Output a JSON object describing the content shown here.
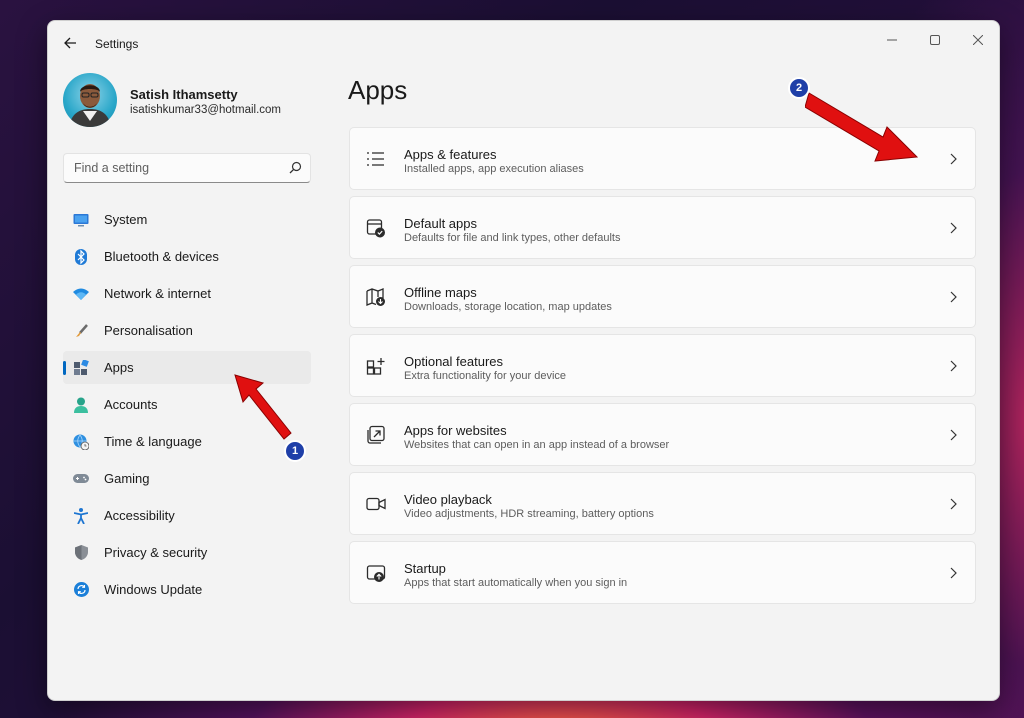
{
  "window": {
    "title": "Settings"
  },
  "profile": {
    "name": "Satish Ithamsetty",
    "email": "isatishkumar33@hotmail.com"
  },
  "search": {
    "placeholder": "Find a setting"
  },
  "nav": {
    "items": [
      {
        "label": "System",
        "icon": "system-icon",
        "selected": false
      },
      {
        "label": "Bluetooth & devices",
        "icon": "bluetooth-icon",
        "selected": false
      },
      {
        "label": "Network & internet",
        "icon": "wifi-icon",
        "selected": false
      },
      {
        "label": "Personalisation",
        "icon": "brush-icon",
        "selected": false
      },
      {
        "label": "Apps",
        "icon": "apps-icon",
        "selected": true
      },
      {
        "label": "Accounts",
        "icon": "person-icon",
        "selected": false
      },
      {
        "label": "Time & language",
        "icon": "globe-clock-icon",
        "selected": false
      },
      {
        "label": "Gaming",
        "icon": "gamepad-icon",
        "selected": false
      },
      {
        "label": "Accessibility",
        "icon": "accessibility-icon",
        "selected": false
      },
      {
        "label": "Privacy & security",
        "icon": "shield-icon",
        "selected": false
      },
      {
        "label": "Windows Update",
        "icon": "update-icon",
        "selected": false
      }
    ]
  },
  "main": {
    "title": "Apps",
    "cards": [
      {
        "title": "Apps & features",
        "description": "Installed apps, app execution aliases",
        "icon": "list-icon"
      },
      {
        "title": "Default apps",
        "description": "Defaults for file and link types, other defaults",
        "icon": "default-apps-icon"
      },
      {
        "title": "Offline maps",
        "description": "Downloads, storage location, map updates",
        "icon": "map-icon"
      },
      {
        "title": "Optional features",
        "description": "Extra functionality for your device",
        "icon": "grid-plus-icon"
      },
      {
        "title": "Apps for websites",
        "description": "Websites that can open in an app instead of a browser",
        "icon": "open-in-app-icon"
      },
      {
        "title": "Video playback",
        "description": "Video adjustments, HDR streaming, battery options",
        "icon": "video-icon"
      },
      {
        "title": "Startup",
        "description": "Apps that start automatically when you sign in",
        "icon": "startup-icon"
      }
    ]
  },
  "annotations": {
    "badge1": "1",
    "badge2": "2"
  },
  "colors": {
    "accent": "#0067c0",
    "annotation_arrow": "#e01010",
    "annotation_badge": "#1f3fa8"
  }
}
